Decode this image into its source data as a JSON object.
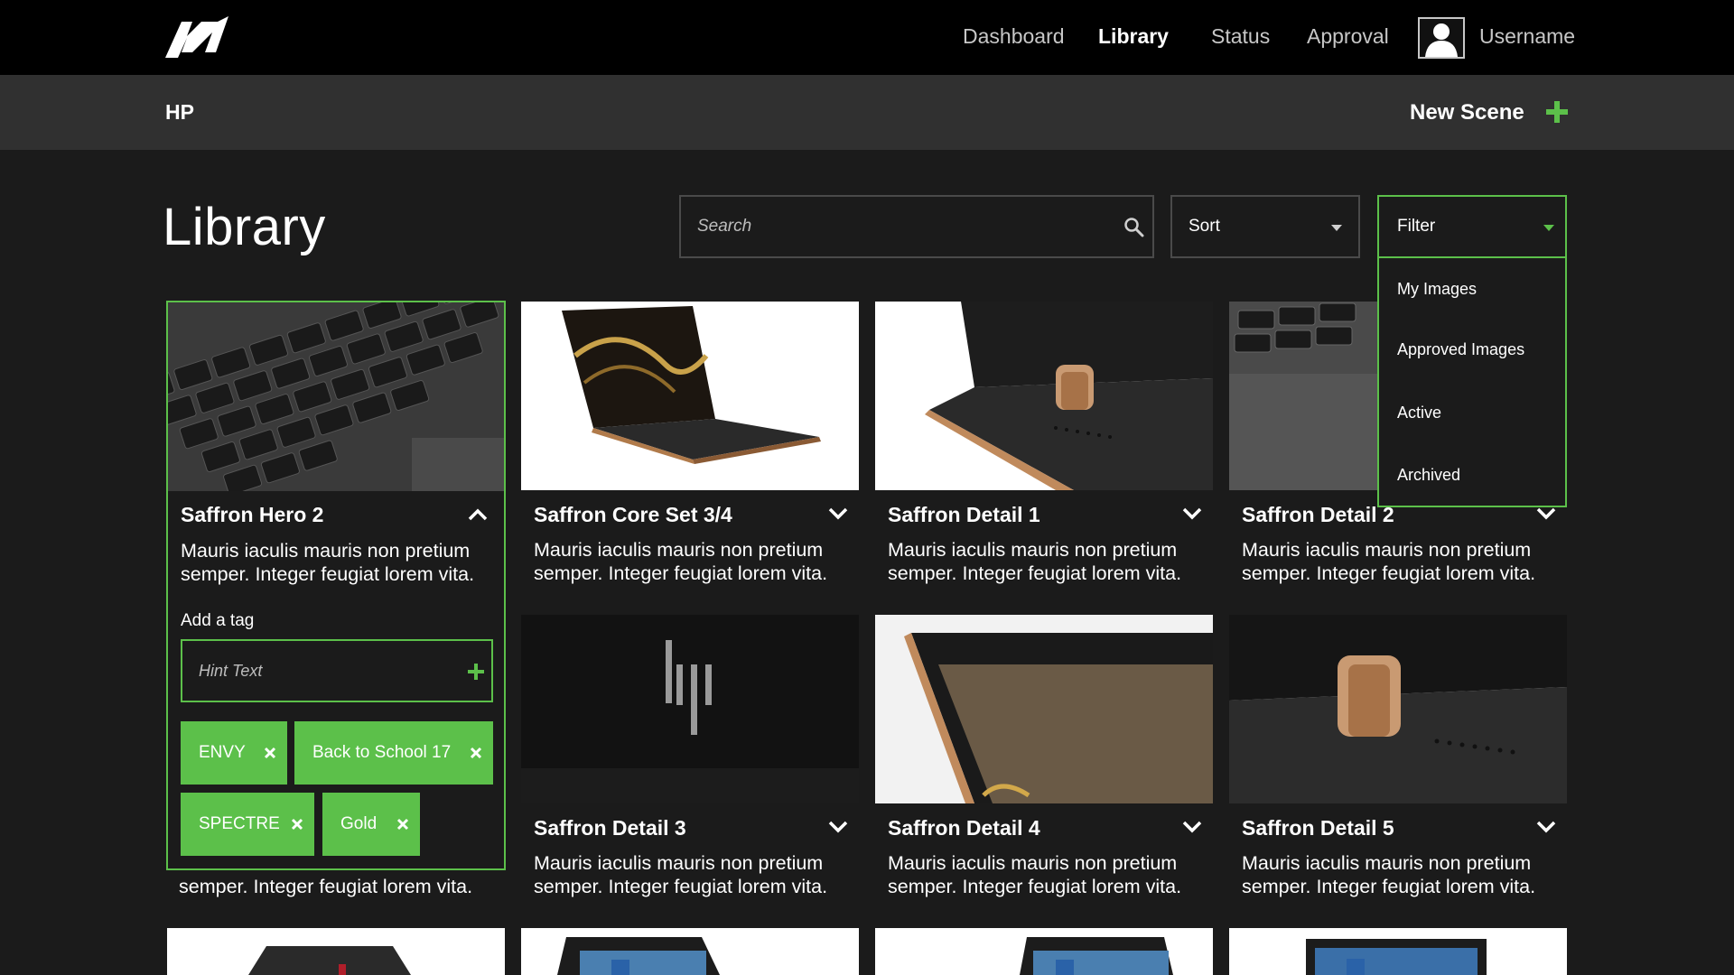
{
  "header": {
    "logo": "N logo",
    "nav": [
      "Dashboard",
      "Library",
      "Status",
      "Approval"
    ],
    "active_nav": "Library",
    "username": "Username"
  },
  "subbar": {
    "brand": "HP",
    "new_scene_label": "New Scene"
  },
  "library": {
    "title": "Library",
    "search_placeholder": "Search",
    "sort_label": "Sort",
    "filter_label": "Filter",
    "filter_options": [
      "My Images",
      "Approved Images",
      "Active",
      "Archived"
    ]
  },
  "cards": [
    {
      "title": "Saffron Hero 2",
      "desc": "Mauris iaculis mauris non pretium semper. Integer feugiat lorem vita."
    },
    {
      "title": "Saffron Core Set 3/4",
      "desc": "Mauris iaculis mauris non pretium semper. Integer feugiat lorem vita."
    },
    {
      "title": "Saffron Detail 1",
      "desc": "Mauris iaculis mauris non pretium semper. Integer feugiat lorem vita."
    },
    {
      "title": "Saffron Detail 2",
      "desc": "Mauris iaculis mauris non pretium semper. Integer feugiat lorem vita."
    },
    {
      "title": "Saffron Detail 3",
      "desc": "Mauris iaculis mauris non pretium semper. Integer feugiat lorem vita."
    },
    {
      "title": "Saffron Detail 4",
      "desc": "Mauris iaculis mauris non pretium semper. Integer feugiat lorem vita."
    },
    {
      "title": "Saffron Detail 5",
      "desc": "Mauris iaculis mauris non pretium semper. Integer feugiat lorem vita."
    }
  ],
  "expanded_card": {
    "add_tag_label": "Add a tag",
    "tag_placeholder": "Hint Text",
    "tags": [
      "ENVY",
      "Back to School 17",
      "SPECTRE",
      "Gold"
    ],
    "under_text": "semper. Integer feugiat lorem vita."
  },
  "colors": {
    "accent": "#5cc04a",
    "topbar": "#000000",
    "subbar": "#303030",
    "background": "#1b1b1b"
  }
}
